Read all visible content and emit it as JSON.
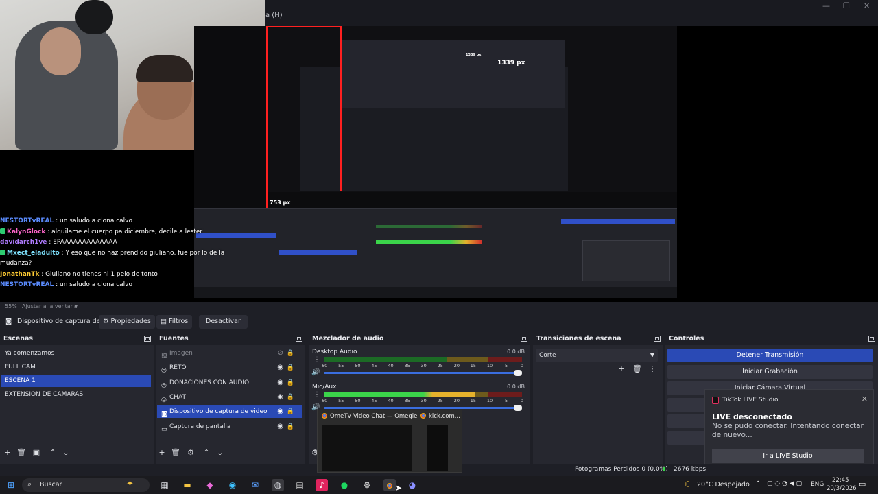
{
  "window": {
    "menu_fragment": "a (H)",
    "minimize": "—",
    "maximize": "❐",
    "close": "✕"
  },
  "preview": {
    "nested_px_horizontal": "1339 px",
    "nested_px_vertical": "753 px",
    "nested_px_inner": "1339 px"
  },
  "chat": [
    {
      "user": "NESTORTvREAL",
      "color": "#5b8cff",
      "badge": false,
      "msg": " : un saludo a clona calvo"
    },
    {
      "user": "KalynGlock",
      "color": "#ff66cc",
      "badge": true,
      "msg": " : alquilame el cuerpo pa diciembre, decile a lester"
    },
    {
      "user": "davidarch1ve",
      "color": "#b07cff",
      "badge": false,
      "msg": " : EPAAAAAAAAAAAAA"
    },
    {
      "user": "Mxect_eladulto",
      "color": "#7fe3ff",
      "badge": true,
      "msg": " : Y eso que no haz prendido giuliano, fue por lo de la"
    },
    {
      "user": "",
      "color": "#ffffff",
      "badge": false,
      "msg": "mudanza?"
    },
    {
      "user": "JonathanTk",
      "color": "#ffcc33",
      "badge": false,
      "msg": " : Giuliano no tienes ni 1 pelo de tonto"
    },
    {
      "user": "NESTORTvREAL",
      "color": "#5b8cff",
      "badge": false,
      "msg": " : un saludo a clona calvo"
    }
  ],
  "zoombar": {
    "zoom": "55%",
    "fit": "Ajustar a la ventana"
  },
  "source_toolbar": {
    "current_source": "Dispositivo de captura de v",
    "properties": "Propiedades",
    "filters": "Filtros",
    "deactivate": "Desactivar"
  },
  "scenes": {
    "title": "Escenas",
    "items": [
      "Ya comenzamos",
      "FULL CAM",
      "ESCENA 1",
      "EXTENSION DE CAMARAS"
    ],
    "selected": 2
  },
  "sources": {
    "title": "Fuentes",
    "items": [
      {
        "label": "Imagen",
        "icon": "image-icon",
        "visible": false
      },
      {
        "label": "RETO",
        "icon": "globe-icon",
        "visible": true
      },
      {
        "label": "DONACIONES CON AUDIO",
        "icon": "globe-icon",
        "visible": true
      },
      {
        "label": "CHAT",
        "icon": "globe-icon",
        "visible": true
      },
      {
        "label": "Dispositivo de captura de video",
        "icon": "camera-icon",
        "visible": true
      },
      {
        "label": "Captura de pantalla",
        "icon": "monitor-icon",
        "visible": true
      }
    ],
    "selected": 4
  },
  "mixer": {
    "title": "Mezclador de audio",
    "channels": [
      {
        "name": "Desktop Audio",
        "db": "0.0 dB",
        "level": 0.0
      },
      {
        "name": "Mic/Aux",
        "db": "0.0 dB",
        "level": 0.76
      }
    ],
    "ticks": [
      "-60",
      "-55",
      "-50",
      "-45",
      "-40",
      "-35",
      "-30",
      "-25",
      "-20",
      "-15",
      "-10",
      "-5",
      "0"
    ]
  },
  "transitions": {
    "title": "Transiciones de escena",
    "selected": "Corte"
  },
  "controls": {
    "title": "Controles",
    "stop_stream": "Detener Transmisión",
    "start_record": "Iniciar Grabación",
    "virtual_cam": "Iniciar Cámara Virtual"
  },
  "toast": {
    "app": "TikTok LIVE Studio",
    "title": "LIVE desconectado",
    "body": "No se pudo conectar. Intentando conectar de nuevo...",
    "button": "Ir a LIVE Studio"
  },
  "status": {
    "dropped": "Fotogramas Perdidos 0 (0.0%)",
    "bitrate": "2676 kbps"
  },
  "thumbnails": [
    {
      "title": "OmeTV Video Chat — Omegle ..."
    },
    {
      "title": "kick.com..."
    }
  ],
  "taskbar": {
    "search": "Buscar",
    "weather": "20°C  Despejado",
    "lang": "ENG",
    "time": "22:45",
    "date": "20/3/2026"
  }
}
